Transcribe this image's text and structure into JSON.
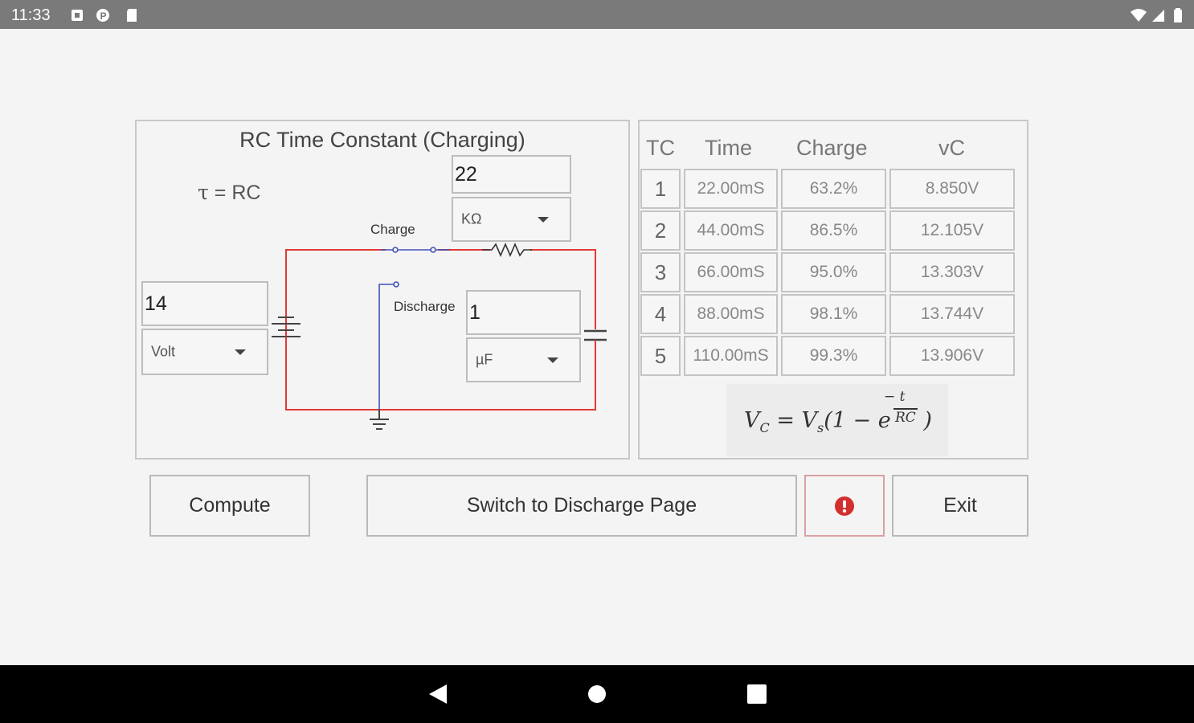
{
  "status_bar": {
    "time": "11:33",
    "icons": [
      "notification-square-icon",
      "p-app-icon",
      "sd-card-icon",
      "wifi-icon",
      "signal-icon",
      "battery-icon"
    ]
  },
  "circuit_panel": {
    "title": "RC Time Constant (Charging)",
    "tau_symbol": "τ",
    "tau_rest": " = RC",
    "resistance_value": "22",
    "resistance_unit": "KΩ",
    "voltage_value": "14",
    "voltage_unit": "Volt",
    "capacitance_value": "1",
    "capacitance_unit": "µF",
    "charge_label": "Charge",
    "discharge_label": "Discharge"
  },
  "results_table": {
    "headers": [
      "TC",
      "Time",
      "Charge",
      "vC"
    ],
    "rows": [
      {
        "tc": "1",
        "time": "22.00mS",
        "charge": "63.2%",
        "vc": "8.850V"
      },
      {
        "tc": "2",
        "time": "44.00mS",
        "charge": "86.5%",
        "vc": "12.105V"
      },
      {
        "tc": "3",
        "time": "66.00mS",
        "charge": "95.0%",
        "vc": "13.303V"
      },
      {
        "tc": "4",
        "time": "88.00mS",
        "charge": "98.1%",
        "vc": "13.744V"
      },
      {
        "tc": "5",
        "time": "110.00mS",
        "charge": "99.3%",
        "vc": "13.906V"
      }
    ],
    "formula": {
      "vc": "V",
      "vc_sub": "C",
      "eq": " = ",
      "vs": "V",
      "vs_sub": "s",
      "open": "(1 − e",
      "close": " )",
      "exp_num": "− t",
      "exp_den": "RC"
    }
  },
  "actions": {
    "compute": "Compute",
    "switch": "Switch to Discharge Page",
    "info_icon": "info-circle-icon",
    "exit": "Exit"
  },
  "colors": {
    "wire_red": "#e53935",
    "wire_blue": "#3f51b5",
    "accent_red": "#d32f2f"
  }
}
